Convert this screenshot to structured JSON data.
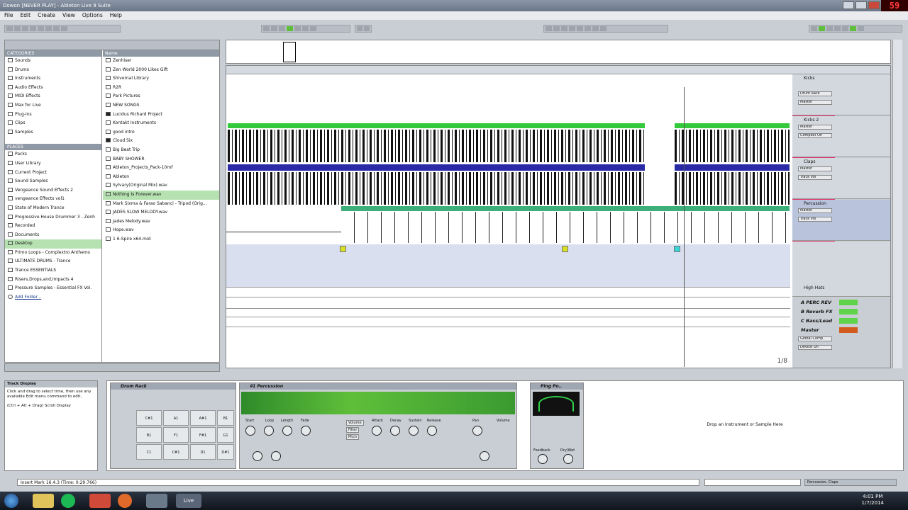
{
  "window": {
    "title": "Dowon  [NEVER PLAY] - Ableton Live 9 Suite",
    "timer": "59"
  },
  "menu": [
    "File",
    "Edit",
    "Create",
    "View",
    "Options",
    "Help"
  ],
  "browser": {
    "categories_header": "CATEGORIES",
    "categories": [
      "Sounds",
      "Drums",
      "Instruments",
      "Audio Effects",
      "MIDI Effects",
      "Max for Live",
      "Plug-ins",
      "Clips",
      "Samples"
    ],
    "places_header": "PLACES",
    "places": [
      "Packs",
      "User Library",
      "Current Project",
      "Sound Samples",
      "Vengeance Sound Effects 2",
      "vengeance Effects vol1",
      "State of Modern Trance",
      "Progressive House Drummer 3 - Zenh",
      "Recorded",
      "Documents",
      "Desktop",
      "Primo Loops - Complextro Anthems",
      "ULTIMATE DRUMS - Trance",
      "Trance ESSENTIALS",
      "Risers,Drops,and,Impacts 4",
      "Pressure Samples - Essential FX Vol.",
      "Add Folder..."
    ],
    "name_header": "Name",
    "items": [
      "Zenhiser",
      "Zen World 2000 Likes Gift",
      "Shivernal Library",
      "R2R",
      "Park Pictures",
      "NEW SONGS",
      "Lucidus Richard Project",
      "Kontakt Instruments",
      "good intro",
      "Cloud Six",
      "Big Beat Trip",
      "BABY SHOWER",
      "Ableton_Projects_Pack-10mf",
      "Ableton",
      "Sylvary(Original Mix).wav",
      "Nothing Is Forever.wav",
      "Mark Sixma & Farao Sabanci - Tripod (Orig...",
      "JADES SLOW MELODY.wav",
      "Jades Melody.wav",
      "Hope.wav",
      "1 6-Spire x64.mid"
    ]
  },
  "tracks": [
    {
      "name": "Kicks",
      "in": "Drum Rack",
      "mon": "Master"
    },
    {
      "name": "Kicks 2",
      "in": "Master",
      "mon": "Compact On"
    },
    {
      "name": "Claps",
      "in": "Master",
      "mon": "Track Vol"
    },
    {
      "name": "Percussion",
      "in": "Master",
      "mon": "Track Vol"
    },
    {
      "name": "High Hats",
      "in": "",
      "mon": ""
    }
  ],
  "returns": [
    {
      "name": "A PERC REV",
      "color": "#5fd34a"
    },
    {
      "name": "B Reverb FX",
      "color": "#5fd34a"
    },
    {
      "name": "C Bass/Lead",
      "color": "#5fd34a"
    },
    {
      "name": "Master",
      "color": "#d25a1d"
    }
  ],
  "master_opts": [
    "Global Comp",
    "Device On"
  ],
  "loop_fraction": "1/8",
  "info": {
    "title": "Track Display",
    "text": "Click and drag to select time, then use any available Edit menu command to edit.",
    "shortcut": "(Ctrl + Alt + Drag) Scroll Display"
  },
  "devices": {
    "drum_rack": {
      "title": "Drum Rack",
      "pads": [
        "C#1",
        "A1",
        "A#1",
        "B1",
        "B1",
        "F1",
        "F#1",
        "G1",
        "C1",
        "C#1",
        "D1",
        "D#1"
      ]
    },
    "simpler": {
      "title": "#1 Percussion",
      "params": [
        "Start",
        "Loop",
        "Length",
        "Fade",
        "Attack",
        "Decay",
        "Sustain",
        "Release",
        "Pan",
        "Volume"
      ],
      "tabs": [
        "Volume",
        "Filter",
        "Pitch"
      ]
    },
    "ping_pong": {
      "title": "Ping Po..",
      "params": [
        "Feedback",
        "Dry/Wet"
      ]
    },
    "drop_message": "Drop an Instrument or Sample Here"
  },
  "status": {
    "text": "Insert Mark 16.4.3 (Time: 0:29:766)",
    "right": "Percussion, Claps"
  },
  "taskbar": {
    "app": "Live",
    "time": "4:01 PM",
    "date": "1/7/2014"
  }
}
